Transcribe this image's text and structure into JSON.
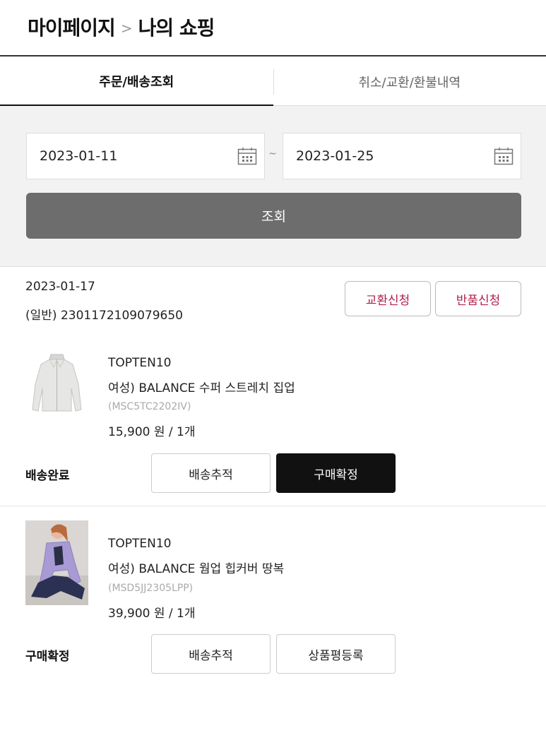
{
  "breadcrumb": {
    "parent": "마이페이지",
    "separator": ">",
    "current": "나의 쇼핑"
  },
  "tabs": [
    {
      "label": "주문/배송조회",
      "active": true
    },
    {
      "label": "취소/교환/환불내역",
      "active": false
    }
  ],
  "filter": {
    "start_date": "2023-01-11",
    "separator": "~",
    "end_date": "2023-01-25",
    "search_label": "조회"
  },
  "order": {
    "date": "2023-01-17",
    "number": "(일반) 2301172109079650",
    "exchange_label": "교환신청",
    "return_label": "반품신청",
    "accent_color": "#b0204b"
  },
  "items": [
    {
      "brand": "TOPTEN10",
      "name": "여성) BALANCE 수퍼 스트레치 집업",
      "code": "(MSC5TC2202IV)",
      "price": "15,900 원 / 1개",
      "status": "배송완료",
      "button1": "배송추적",
      "button2": "구매확정"
    },
    {
      "brand": "TOPTEN10",
      "name": "여성) BALANCE 웜업 힙커버 땅복",
      "code": "(MSD5JJ2305LPP)",
      "price": "39,900 원 / 1개",
      "status": "구매확정",
      "button1": "배송추적",
      "button2": "상품평등록"
    }
  ]
}
